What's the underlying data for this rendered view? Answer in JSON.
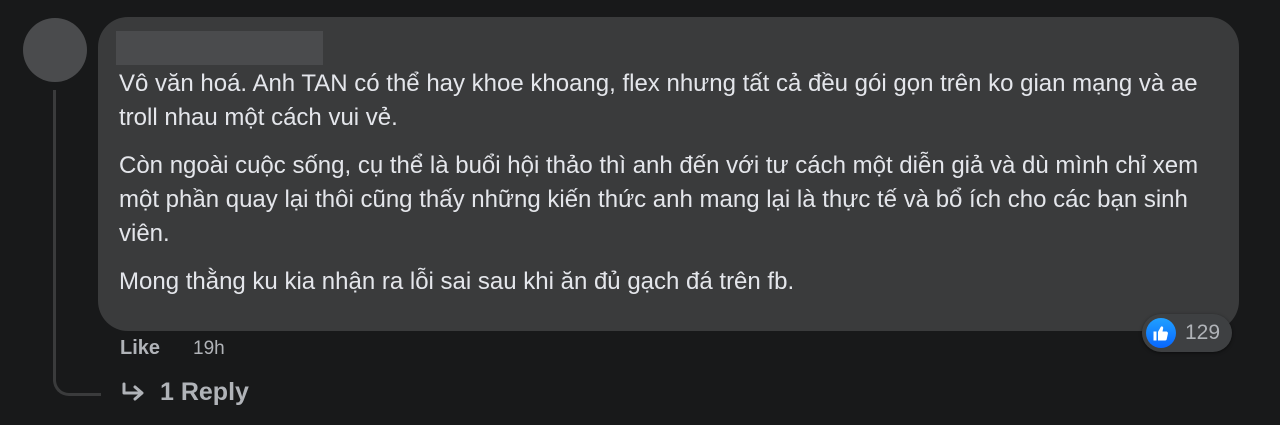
{
  "comment": {
    "paragraphs": [
      "Vô văn hoá. Anh TAN có thể hay khoe khoang, flex nhưng tất cả đều gói gọn trên ko gian mạng và ae troll nhau một cách vui vẻ.",
      "Còn ngoài cuộc sống, cụ thể là buổi hội thảo thì anh đến với tư cách một diễn giả và dù mình chỉ xem một phần quay lại thôi cũng thấy những kiến thức anh mang lại là thực tế và bổ ích cho các bạn sinh viên.",
      "Mong thằng ku kia nhận ra lỗi sai sau khi ăn đủ gạch đá trên fb."
    ],
    "reaction_icon": "like-icon",
    "reaction_count": "129"
  },
  "actions": {
    "like_label": "Like",
    "timestamp": "19h",
    "reply_label": "1 Reply",
    "reply_icon": "reply-arrow-icon"
  },
  "colors": {
    "background": "#18191a",
    "bubble": "#3a3b3c",
    "text": "#e4e6eb",
    "secondary_text": "#b0b3b8",
    "like_blue": "#0866ff"
  }
}
